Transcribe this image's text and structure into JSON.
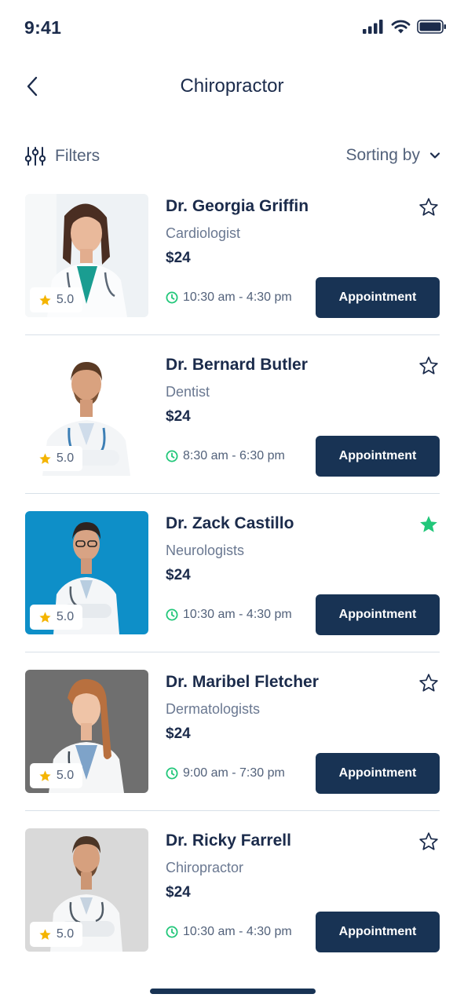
{
  "status_bar": {
    "time": "9:41"
  },
  "header": {
    "title": "Chiropractor"
  },
  "toolbar": {
    "filters_label": "Filters",
    "sort_label": "Sorting by"
  },
  "colors": {
    "primary": "#183354",
    "accent_green": "#22c77a",
    "star_gold": "#f4b400",
    "text_dark": "#1b2b4b",
    "text_muted": "#6a7891"
  },
  "doctors": [
    {
      "name": "Dr. Georgia Griffin",
      "specialty": "Cardiologist",
      "price": "$24",
      "rating": "5.0",
      "hours": "10:30 am - 4:30 pm",
      "button": "Appointment",
      "favorite": false
    },
    {
      "name": "Dr. Bernard Butler",
      "specialty": "Dentist",
      "price": "$24",
      "rating": "5.0",
      "hours": "8:30 am - 6:30 pm",
      "button": "Appointment",
      "favorite": false
    },
    {
      "name": "Dr. Zack Castillo",
      "specialty": "Neurologists",
      "price": "$24",
      "rating": "5.0",
      "hours": "10:30 am - 4:30 pm",
      "button": "Appointment",
      "favorite": true
    },
    {
      "name": "Dr. Maribel Fletcher",
      "specialty": "Dermatologists",
      "price": "$24",
      "rating": "5.0",
      "hours": "9:00 am - 7:30 pm",
      "button": "Appointment",
      "favorite": false
    },
    {
      "name": "Dr. Ricky Farrell",
      "specialty": "Chiropractor",
      "price": "$24",
      "rating": "5.0",
      "hours": "10:30 am - 4:30 pm",
      "button": "Appointment",
      "favorite": false
    }
  ]
}
